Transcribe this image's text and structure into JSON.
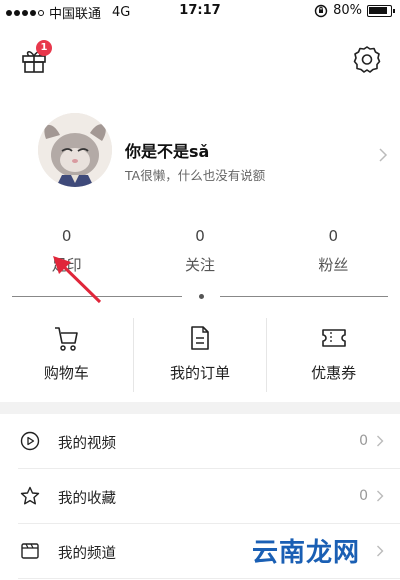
{
  "status_bar": {
    "carrier": "中国联通",
    "network": "4G",
    "time": "17:17",
    "battery": "80%",
    "battery_level": 0.8
  },
  "header": {
    "gift_badge": "1",
    "gift_icon": "gift-icon",
    "settings_icon": "gear-icon"
  },
  "profile": {
    "username": "你是不是sǎ",
    "bio": "TA很懒，什么也没有说额"
  },
  "stats": [
    {
      "count": "0",
      "label": "足印"
    },
    {
      "count": "0",
      "label": "关注"
    },
    {
      "count": "0",
      "label": "粉丝"
    }
  ],
  "shortcuts": [
    {
      "label": "购物车",
      "icon": "cart-icon"
    },
    {
      "label": "我的订单",
      "icon": "document-icon"
    },
    {
      "label": "优惠券",
      "icon": "coupon-icon"
    }
  ],
  "menu": [
    {
      "label": "我的视频",
      "count": "0",
      "icon": "play-circle-icon"
    },
    {
      "label": "我的收藏",
      "count": "0",
      "icon": "star-icon"
    },
    {
      "label": "我的频道",
      "count": "",
      "icon": "channel-icon"
    }
  ],
  "watermark": "云南龙网",
  "colors": {
    "badge": "#e8384c",
    "arrow": "#e0263a",
    "watermark": "#1a5fb4"
  }
}
